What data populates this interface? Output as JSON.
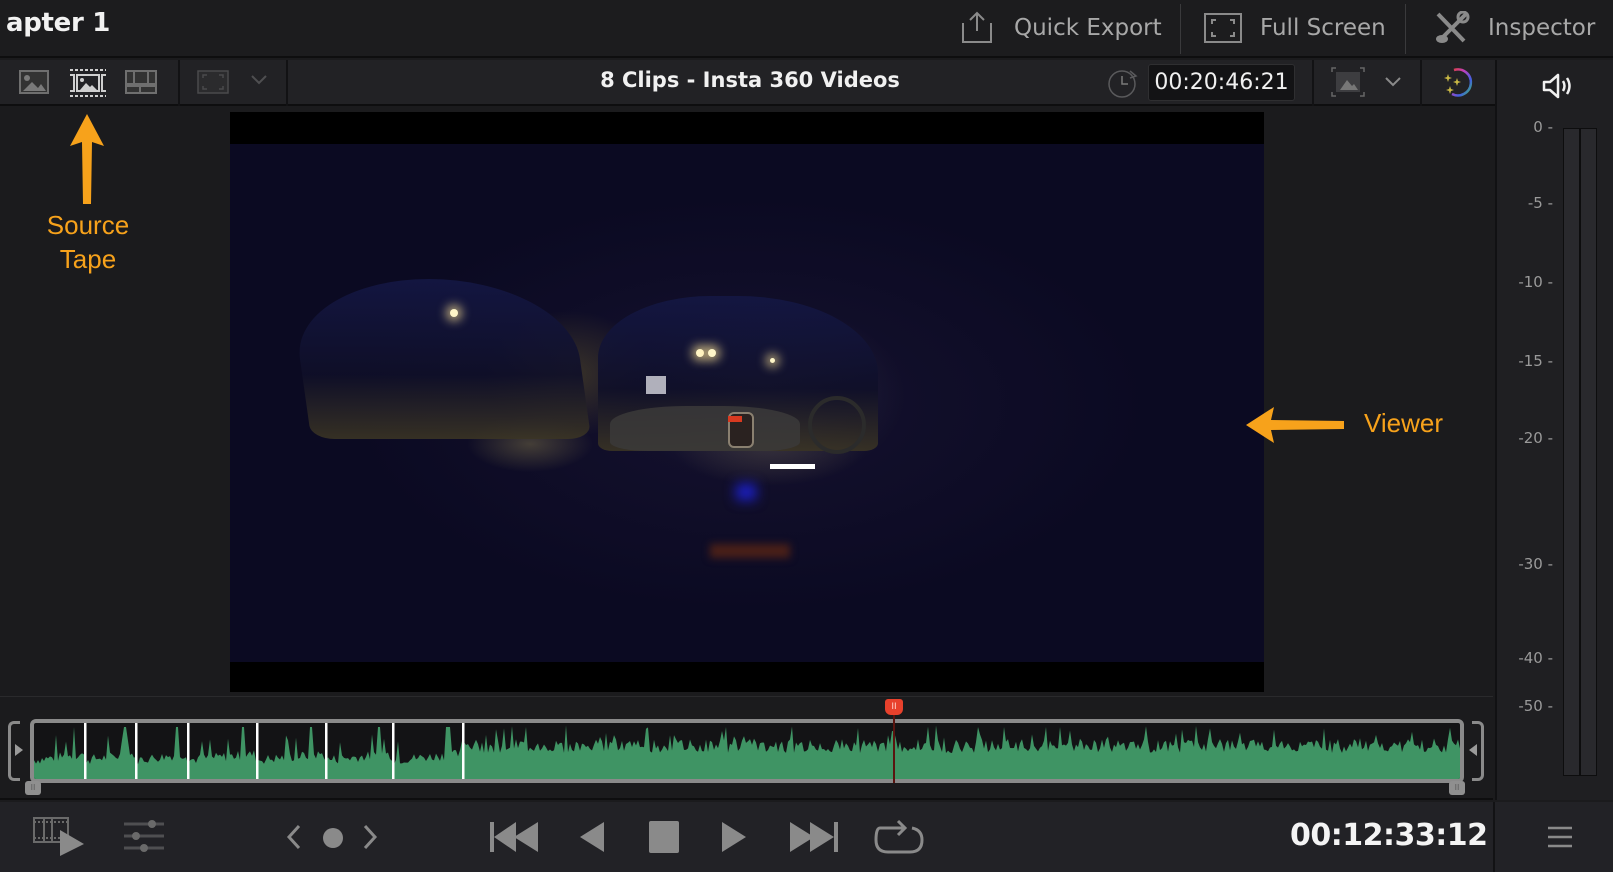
{
  "header": {
    "title": "apter 1",
    "buttons": [
      {
        "label": "Quick Export",
        "icon": "export-icon"
      },
      {
        "label": "Full Screen",
        "icon": "fullscreen-icon"
      },
      {
        "label": "Inspector",
        "icon": "inspector-icon"
      }
    ]
  },
  "toolbar": {
    "viewer_title": "8 Clips - Insta 360 Videos",
    "source_timecode": "00:20:46:21",
    "view_modes": [
      "source-clip-icon",
      "source-tape-icon",
      "timeline-icon"
    ],
    "safe_area_icon": "safe-area-icon",
    "clock_icon": "timecode-clock-icon",
    "zoom_icon": "viewer-zoom-icon",
    "fx_icon": "smart-reframe-icon",
    "audio_icon": "speaker-icon"
  },
  "annotations": {
    "source_tape": "Source\nTape",
    "viewer": "Viewer",
    "color": "#f7a21b"
  },
  "meter": {
    "labels": [
      "0",
      "-5",
      "-10",
      "-15",
      "-20",
      "-30",
      "-40",
      "-50"
    ]
  },
  "timeline": {
    "clip_count": 8,
    "playhead_position": 0.605,
    "waveform_color": "#3f9464",
    "playhead_color": "#e8412c"
  },
  "transport": {
    "current_timecode": "00:12:33:12",
    "buttons": [
      "go-to-start-icon",
      "reverse-play-icon",
      "stop-icon",
      "play-icon",
      "go-to-end-icon",
      "loop-icon"
    ],
    "left_tools": [
      "clip-playback-icon",
      "adjust-sliders-icon"
    ],
    "nav": [
      "prev-marker-icon",
      "marker-icon",
      "next-marker-icon"
    ],
    "menu_icon": "hamburger-menu-icon"
  }
}
